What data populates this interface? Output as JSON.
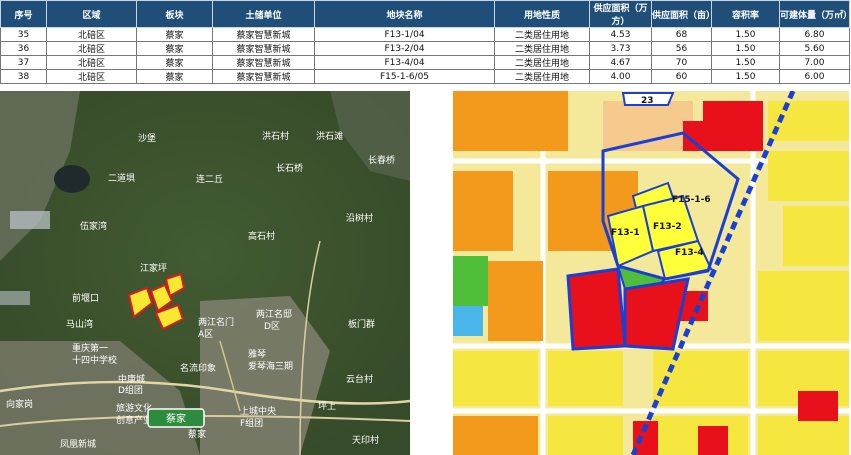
{
  "table": {
    "headers": [
      "序号",
      "区域",
      "板块",
      "土储单位",
      "地块名称",
      "用地性质",
      "供应面积（万方）",
      "供应面积（亩）",
      "容积率",
      "可建体量（万㎡）"
    ],
    "rows": [
      {
        "no": "35",
        "district": "北碚区",
        "block": "蔡家",
        "unit": "蔡家智慧新城",
        "parcel": "F13-1/04",
        "usage": "二类居住用地",
        "area_wan": "4.53",
        "area_mu": "68",
        "far": "1.50",
        "volume": "6.80"
      },
      {
        "no": "36",
        "district": "北碚区",
        "block": "蔡家",
        "unit": "蔡家智慧新城",
        "parcel": "F13-2/04",
        "usage": "二类居住用地",
        "area_wan": "3.73",
        "area_mu": "56",
        "far": "1.50",
        "volume": "5.60"
      },
      {
        "no": "37",
        "district": "北碚区",
        "block": "蔡家",
        "unit": "蔡家智慧新城",
        "parcel": "F13-4/04",
        "usage": "二类居住用地",
        "area_wan": "4.67",
        "area_mu": "70",
        "far": "1.50",
        "volume": "7.00"
      },
      {
        "no": "38",
        "district": "北碚区",
        "block": "蔡家",
        "unit": "蔡家智慧新城",
        "parcel": "F15-1-6/05",
        "usage": "二类居住用地",
        "area_wan": "4.00",
        "area_mu": "60",
        "far": "1.50",
        "volume": "6.00"
      }
    ]
  },
  "satellite_map": {
    "labels": {
      "shabao": "沙堡",
      "hongshicun": "洪石村",
      "hongshiyan": "洪石滩",
      "ersuoba": "二道埧",
      "lianerqiu": "连二丘",
      "changshiqiao": "长石桥",
      "changchunqiao": "长春桥",
      "yanshancun": "沿树村",
      "gaoshicun": "高石村",
      "wujiawan": "伍家湾",
      "jiangjiaping": "江家坪",
      "qiandanggou": "前堰口",
      "majiawan": "马山湾",
      "liangjiangmingmen_a": "两江名门",
      "a_area": "A区",
      "liangjiangmingmen_d": "两江名邸",
      "d_area": "D区",
      "chongqing_school": "重庆第一",
      "school_name": "十四中学校",
      "mingyuanyinxiang": "名流印象",
      "jingqin": "雅琴",
      "aiqinhai": "爱琴海三期",
      "banmenjun": "板门群",
      "zhongkang": "中康城",
      "d_group": "D组团",
      "lvyouwenhua": "旅游文化",
      "chuangyiyuan": "创意产业",
      "caijia_badge": "蔡家",
      "caijia": "蔡家",
      "shangchengzhongyang": "上城中央",
      "f_group": "F组团",
      "xiangjiagang": "向家岗",
      "yuntaicun": "云台村",
      "pingshang": "坪上",
      "tianyincun": "天印村",
      "fenghuang": "凤凰新城"
    }
  },
  "plan_map": {
    "labels": {
      "f15": "F15-1-6",
      "f13_1": "F13-1",
      "f13_2": "F13-2",
      "f13_4": "F13-4",
      "top_code": "23"
    },
    "colors": {
      "residential": "#f6e640",
      "commercial": "#e8101a",
      "public": "#f39a1c",
      "green": "#4fbf3a",
      "road": "#e9e9e9",
      "outline": "#1a3fd6",
      "highlight": "#ffff3a"
    }
  }
}
